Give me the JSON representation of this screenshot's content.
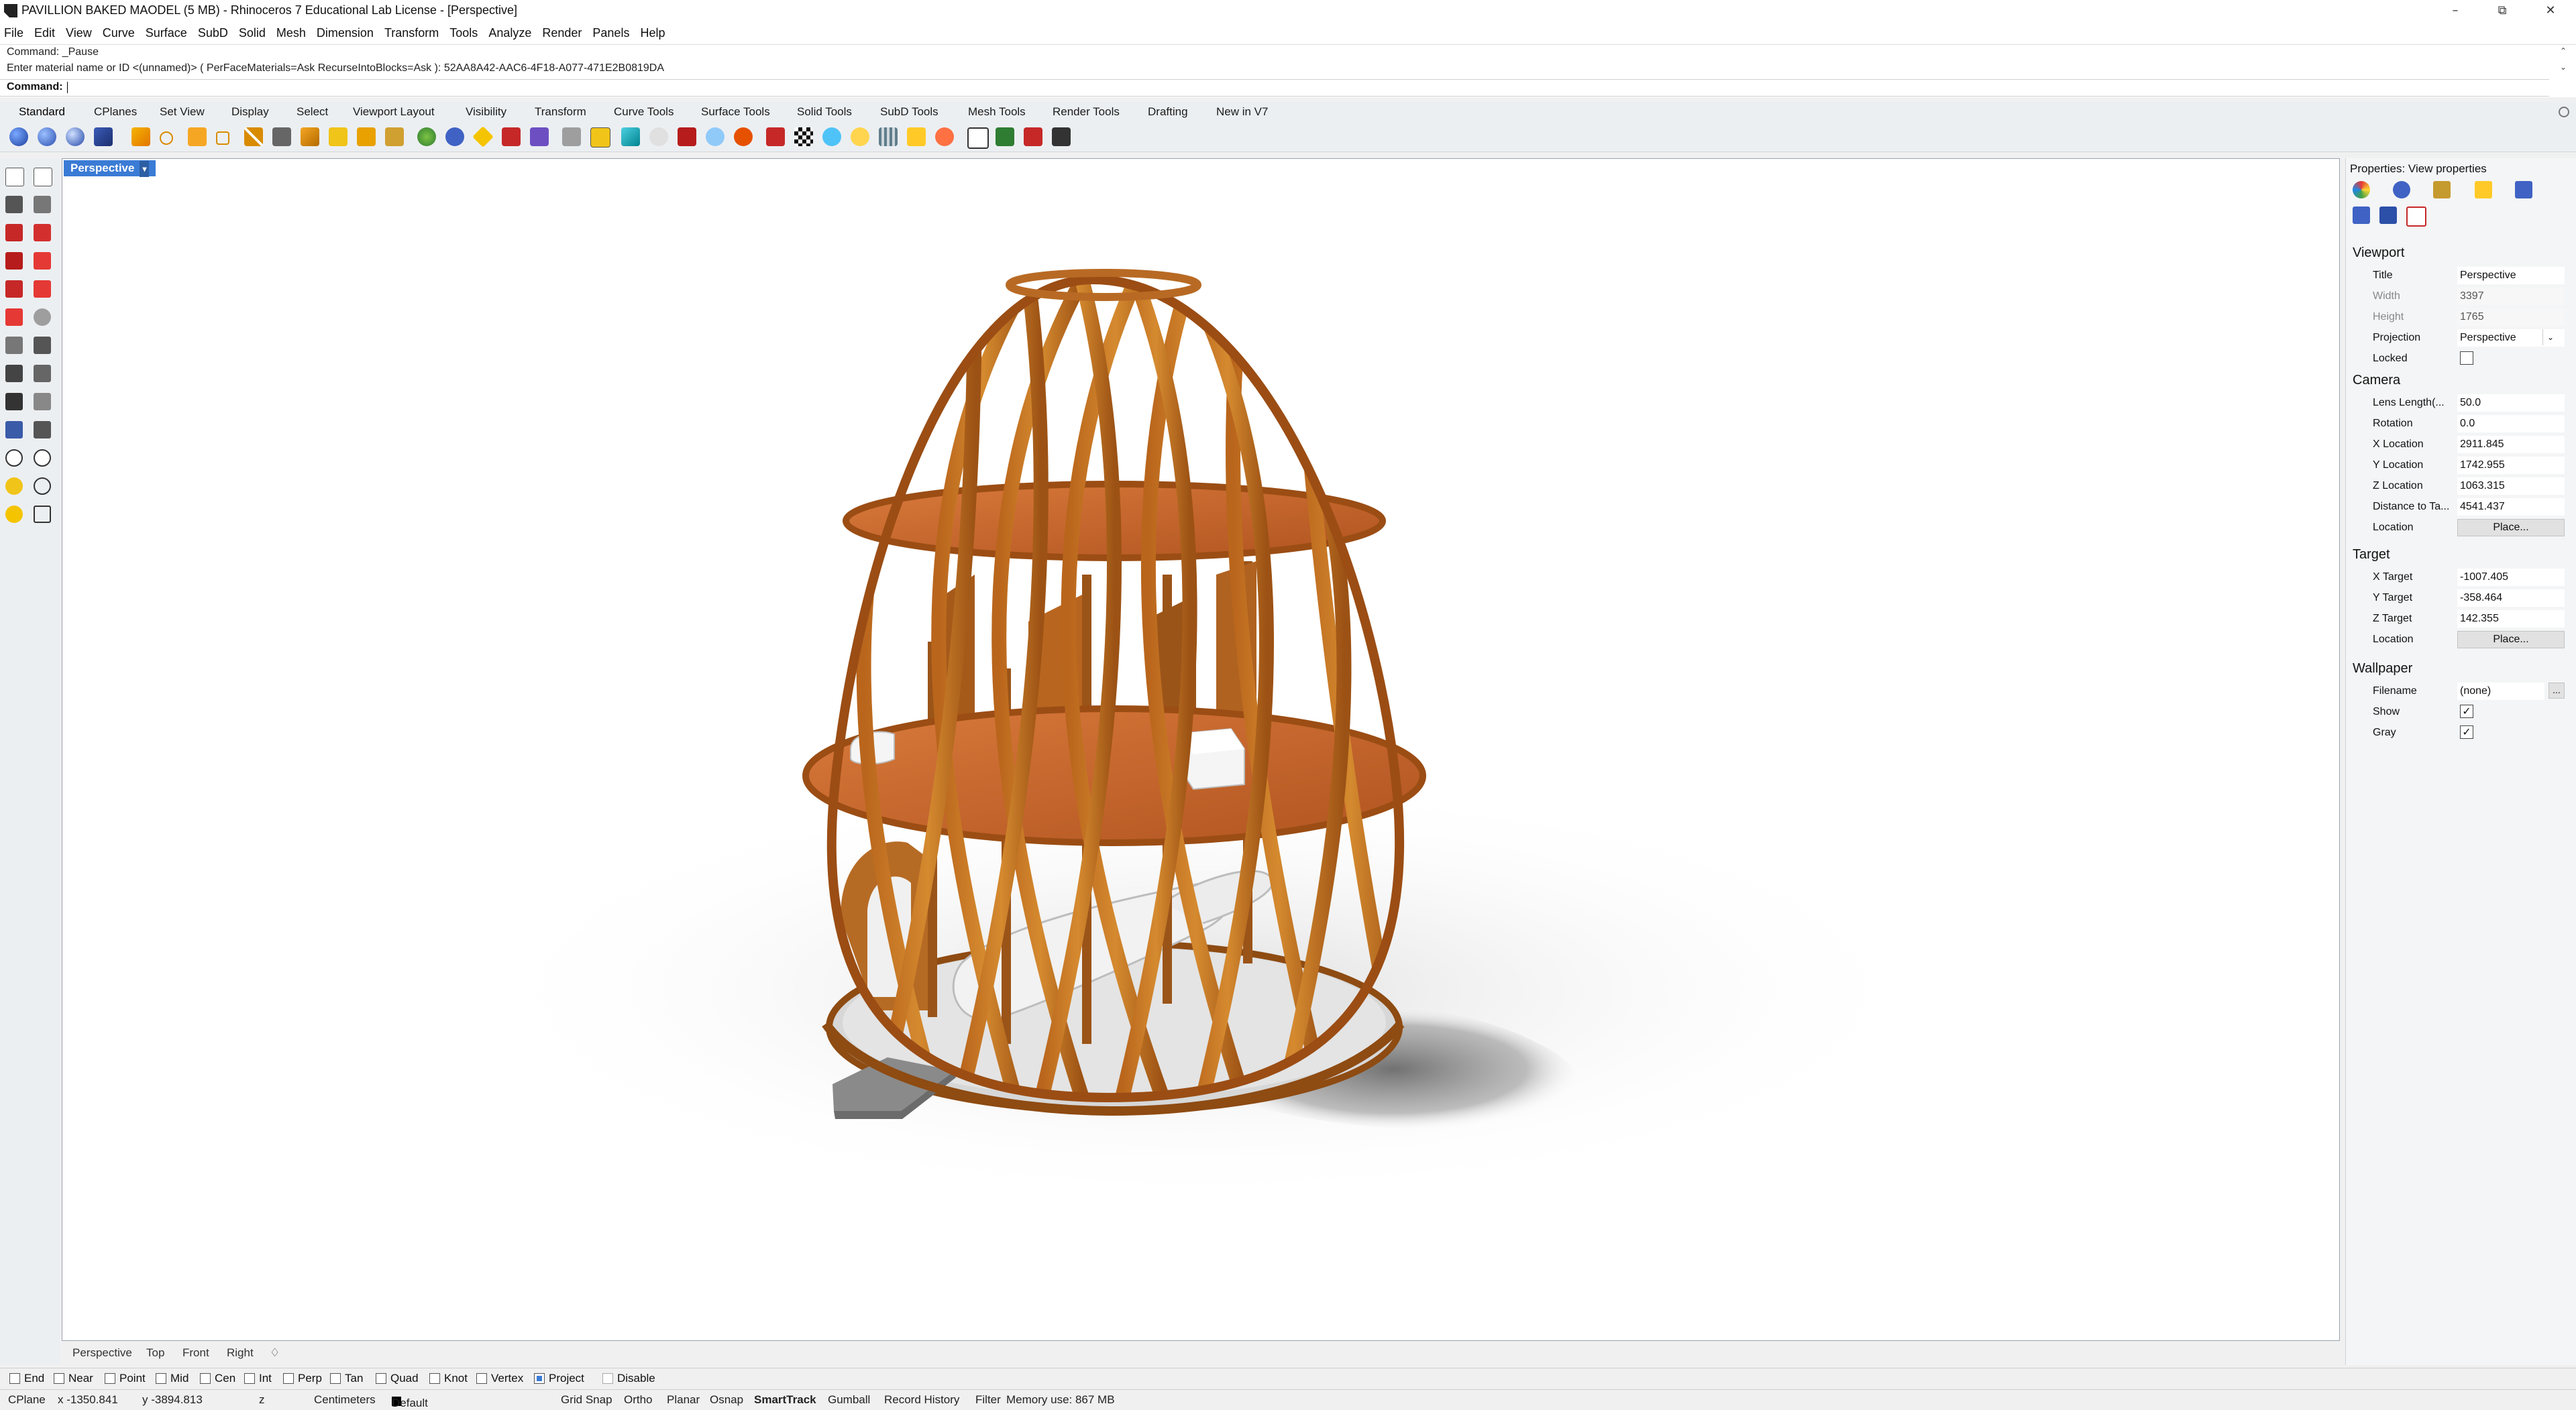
{
  "window": {
    "title": "PAVILLION BAKED MAODEL (5 MB) - Rhinoceros 7 Educational Lab License - [Perspective]",
    "minimize_glyph": "–",
    "maximize_glyph": "⧉",
    "close_glyph": "✕"
  },
  "menu": [
    "File",
    "Edit",
    "View",
    "Curve",
    "Surface",
    "SubD",
    "Solid",
    "Mesh",
    "Dimension",
    "Transform",
    "Tools",
    "Analyze",
    "Render",
    "Panels",
    "Help"
  ],
  "command": {
    "history_1": "Command: _Pause",
    "history_2": "Enter material name or ID <(unnamed)> ( PerFaceMaterials=Ask  RecurseIntoBlocks=Ask ): 52AA8A42-AAC6-4F18-A077-471E2B0819DA",
    "prompt_label": "Command:",
    "scroll_up": "⌃",
    "scroll_down": "⌄"
  },
  "toolbar_tabs": [
    "Standard",
    "CPlanes",
    "Set View",
    "Display",
    "Select",
    "Viewport Layout",
    "Visibility",
    "Transform",
    "Curve Tools",
    "Surface Tools",
    "Solid Tools",
    "SubD Tools",
    "Mesh Tools",
    "Render Tools",
    "Drafting",
    "New in V7"
  ],
  "viewport": {
    "label": "Perspective",
    "label_caret": "▾",
    "tabs": [
      "Perspective",
      "Top",
      "Front",
      "Right"
    ],
    "add_tab": "♢"
  },
  "osnap": {
    "items": [
      {
        "label": "End",
        "checked": false
      },
      {
        "label": "Near",
        "checked": false
      },
      {
        "label": "Point",
        "checked": false
      },
      {
        "label": "Mid",
        "checked": false
      },
      {
        "label": "Cen",
        "checked": false
      },
      {
        "label": "Int",
        "checked": false
      },
      {
        "label": "Perp",
        "checked": false
      },
      {
        "label": "Tan",
        "checked": false
      },
      {
        "label": "Quad",
        "checked": false
      },
      {
        "label": "Knot",
        "checked": false
      },
      {
        "label": "Vertex",
        "checked": false
      },
      {
        "label": "Project",
        "checked": true
      },
      {
        "label": "Disable",
        "checked": false
      }
    ]
  },
  "status": {
    "cplane": "CPlane",
    "x": "x -1350.841",
    "y": "y -3894.813",
    "z": "z",
    "units": "Centimeters",
    "layer": "Default",
    "grid_snap": "Grid Snap",
    "ortho": "Ortho",
    "planar": "Planar",
    "osnap": "Osnap",
    "smarttrack": "SmartTrack",
    "gumball": "Gumball",
    "record_history": "Record History",
    "filter": "Filter",
    "memory": "Memory use: 867 MB"
  },
  "properties": {
    "panel_title": "Properties: View properties",
    "viewport_section": "Viewport",
    "title_label": "Title",
    "title_value": "Perspective",
    "width_label": "Width",
    "width_value": "3397",
    "height_label": "Height",
    "height_value": "1765",
    "projection_label": "Projection",
    "projection_value": "Perspective",
    "dropdown_caret": "⌄",
    "locked_label": "Locked",
    "camera_section": "Camera",
    "lens_label": "Lens Length(...",
    "lens_value": "50.0",
    "rotation_label": "Rotation",
    "rotation_value": "0.0",
    "xloc_label": "X Location",
    "xloc_value": "2911.845",
    "yloc_label": "Y Location",
    "yloc_value": "1742.955",
    "zloc_label": "Z Location",
    "zloc_value": "1063.315",
    "dist_label": "Distance to Ta...",
    "dist_value": "4541.437",
    "loc_label": "Location",
    "place_button": "Place...",
    "target_section": "Target",
    "xt_label": "X Target",
    "xt_value": "-1007.405",
    "yt_label": "Y Target",
    "yt_value": "-358.464",
    "zt_label": "Z Target",
    "zt_value": "142.355",
    "tloc_label": "Location",
    "tplace_button": "Place...",
    "wallpaper_section": "Wallpaper",
    "filename_label": "Filename",
    "filename_value": "(none)",
    "browse_button": "...",
    "show_label": "Show",
    "show_checked": "✓",
    "gray_label": "Gray",
    "gray_checked": "✓"
  }
}
